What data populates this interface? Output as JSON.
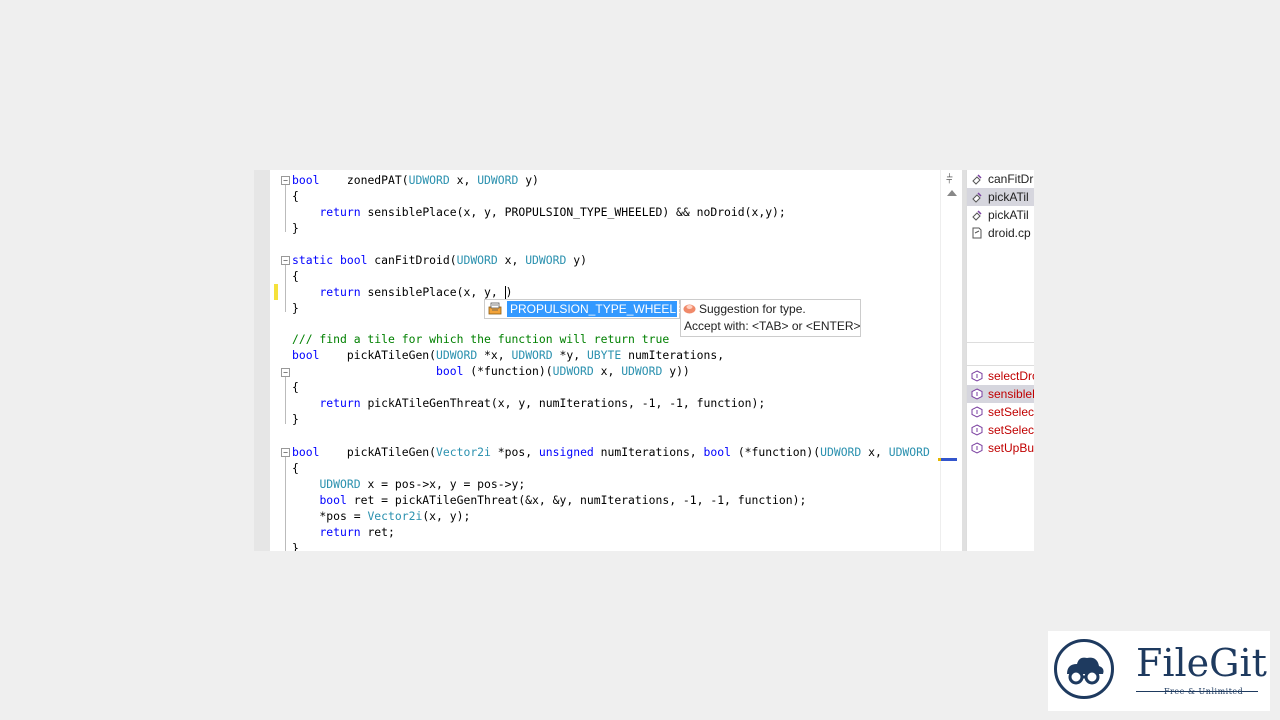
{
  "colors": {
    "keyword": "#0000ff",
    "type": "#2b91af",
    "comment": "#008000",
    "selection": "#3399ff",
    "member": "#c00000",
    "brand": "#1e3a5f"
  },
  "code": {
    "lines": [
      "bool    zonedPAT(UDWORD x, UDWORD y)",
      "{",
      "    return sensiblePlace(x, y, PROPULSION_TYPE_WHEELED) && noDroid(x,y);",
      "}",
      "",
      "static bool canFitDroid(UDWORD x, UDWORD y)",
      "{",
      "    return sensiblePlace(x, y, ",
      "}",
      "",
      "/// find a tile for which the function will return true",
      "bool    pickATileGen(UDWORD *x, UDWORD *y, UBYTE numIterations,",
      "                     bool (*function)(UDWORD x, UDWORD y))",
      "{",
      "    return pickATileGenThreat(x, y, numIterations, -1, -1, function);",
      "}",
      "",
      "bool    pickATileGen(Vector2i *pos, unsigned numIterations, bool (*function)(UDWORD x, UDWORD",
      "{",
      "    UDWORD x = pos->x, y = pos->y;",
      "    bool ret = pickATileGenThreat(&x, &y, numIterations, -1, -1, function);",
      "    *pos = Vector2i(x, y);",
      "    return ret;",
      "}"
    ]
  },
  "autocomplete": {
    "selected_item": "PROPULSION_TYPE_WHEELED",
    "icon": "enum-member-icon"
  },
  "tooltip": {
    "line1": "Suggestion for type.",
    "line2": "Accept with: <TAB> or <ENTER>",
    "icon": "suggestion-bulb-icon"
  },
  "side_panel": {
    "top_items": [
      {
        "label": "canFitDr",
        "icon": "function-icon"
      },
      {
        "label": "pickATil",
        "icon": "function-icon"
      },
      {
        "label": "pickATil",
        "icon": "function-icon"
      },
      {
        "label": "droid.cp",
        "icon": "file-icon"
      }
    ],
    "bottom_items": [
      {
        "label": "selectDro",
        "icon": "member-icon"
      },
      {
        "label": "sensibleF",
        "icon": "member-icon"
      },
      {
        "label": "setSelect",
        "icon": "member-icon"
      },
      {
        "label": "setSelect",
        "icon": "member-icon"
      },
      {
        "label": "setUpBu",
        "icon": "member-icon"
      }
    ]
  },
  "logo": {
    "brand": "FileGit",
    "tagline": "Free & Unlimited"
  }
}
